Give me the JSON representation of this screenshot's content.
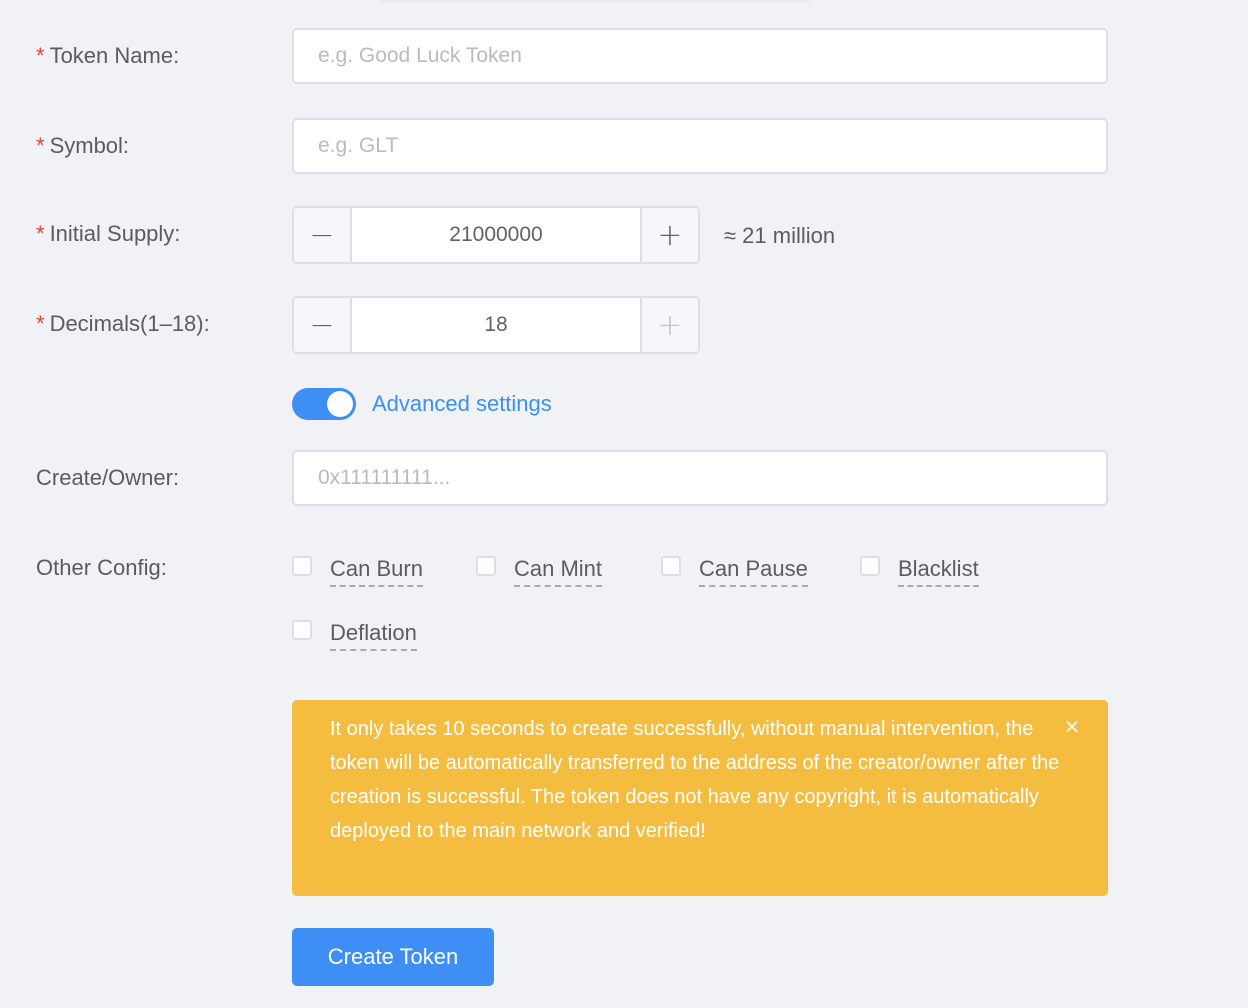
{
  "form": {
    "token_name": {
      "required_mark": "*",
      "label": "Token Name:",
      "placeholder": "e.g. Good Luck Token",
      "value": ""
    },
    "symbol": {
      "required_mark": "*",
      "label": "Symbol:",
      "placeholder": "e.g. GLT",
      "value": ""
    },
    "initial_supply": {
      "required_mark": "*",
      "label": "Initial Supply:",
      "minus": "−",
      "plus": "+",
      "value": "21000000",
      "approx_text": "≈ 21 million"
    },
    "decimals": {
      "required_mark": "*",
      "label": "Decimals(1–18):",
      "minus": "−",
      "plus": "+",
      "value": "18",
      "plus_disabled": true
    },
    "advanced": {
      "label": "Advanced settings",
      "enabled": true,
      "accent_color": "#3d8ef5"
    },
    "owner": {
      "label": "Create/Owner:",
      "placeholder": "0x111111111...",
      "value": ""
    },
    "other_config": {
      "label": "Other Config:",
      "options": [
        {
          "label": "Can Burn",
          "checked": false
        },
        {
          "label": "Can Mint",
          "checked": false
        },
        {
          "label": "Can Pause",
          "checked": false
        },
        {
          "label": "Blacklist",
          "checked": false
        },
        {
          "label": "Deflation",
          "checked": false
        }
      ]
    }
  },
  "alert": {
    "text": "It only takes 10 seconds to create successfully, without manual intervention, the token will be automatically transferred to the address of the creator/owner after the creation is successful. The token does not have any copyright, it is automatically deployed to the main network and verified!",
    "close_icon": "×",
    "color": "#f5bd40"
  },
  "actions": {
    "create_label": "Create Token",
    "color": "#3d8ef5"
  }
}
